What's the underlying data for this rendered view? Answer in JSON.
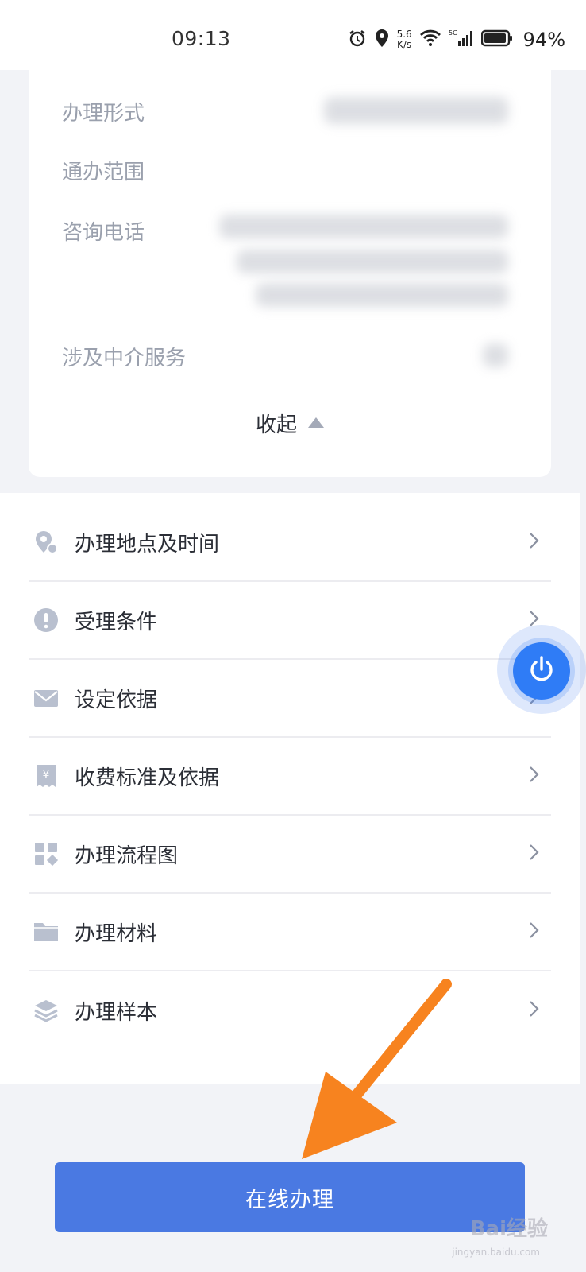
{
  "status_bar": {
    "time": "09:13",
    "speed_value": "5.6",
    "speed_unit": "K/s",
    "battery": "94%",
    "icons": [
      "alarm-icon",
      "location-icon",
      "wifi-icon",
      "signal-5g-icon",
      "battery-icon"
    ]
  },
  "details": {
    "fields": [
      {
        "label": "办理形式"
      },
      {
        "label": "通办范围"
      },
      {
        "label": "咨询电话"
      },
      {
        "label": "涉及中介服务"
      }
    ],
    "collapse_label": "收起"
  },
  "menu": {
    "items": [
      {
        "label": "办理地点及时间",
        "icon": "location-pin-icon"
      },
      {
        "label": "受理条件",
        "icon": "exclamation-circle-icon"
      },
      {
        "label": "设定依据",
        "icon": "envelope-icon"
      },
      {
        "label": "收费标准及依据",
        "icon": "receipt-yen-icon"
      },
      {
        "label": "办理流程图",
        "icon": "flowchart-icon"
      },
      {
        "label": "办理材料",
        "icon": "folder-icon"
      },
      {
        "label": "办理样本",
        "icon": "layers-icon"
      }
    ]
  },
  "actions": {
    "online_label": "在线办理"
  },
  "watermark": {
    "brand": "Bai经验",
    "sub": "jingyan.baidu.com"
  },
  "colors": {
    "primary": "#4a79e2",
    "float_button": "#2f7cf6",
    "annotation_arrow": "#f7831f",
    "label_gray": "#9aa0ad"
  }
}
